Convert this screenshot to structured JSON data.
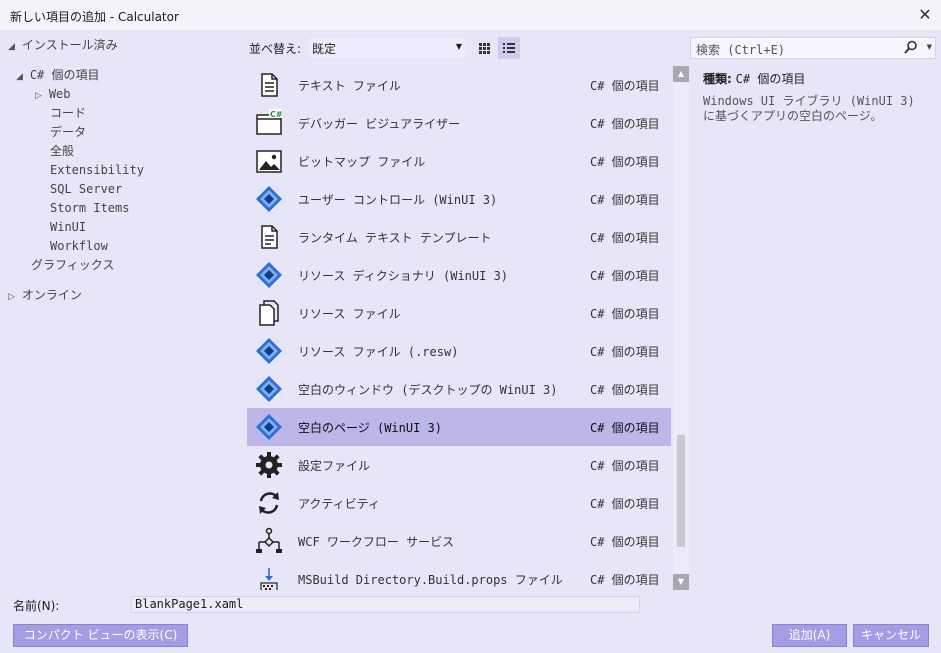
{
  "window": {
    "title": "新しい項目の追加 - Calculator",
    "close_glyph": "✕"
  },
  "tree": {
    "installed": "インストール済み",
    "csharp": "C# 個の項目",
    "web": "Web",
    "code": "コード",
    "data": "データ",
    "general": "全般",
    "extensibility": "Extensibility",
    "sql": "SQL Server",
    "storm": "Storm Items",
    "winui": "WinUI",
    "workflow": "Workflow",
    "graphics": "グラフィックス",
    "online": "オンライン"
  },
  "toolbar": {
    "sort_label": "並べ替え:",
    "sort_value": "既定"
  },
  "search": {
    "placeholder": "検索 (Ctrl+E)"
  },
  "templates": [
    {
      "name": "テキスト ファイル",
      "category": "C# 個の項目",
      "icon": "document-icon"
    },
    {
      "name": "デバッガー ビジュアライザー",
      "category": "C# 個の項目",
      "icon": "debugger-visualizer-icon"
    },
    {
      "name": "ビットマップ ファイル",
      "category": "C# 個の項目",
      "icon": "bitmap-icon"
    },
    {
      "name": "ユーザー コントロール (WinUI 3)",
      "category": "C# 個の項目",
      "icon": "winui-icon"
    },
    {
      "name": "ランタイム テキスト テンプレート",
      "category": "C# 個の項目",
      "icon": "text-template-icon"
    },
    {
      "name": "リソース ディクショナリ (WinUI 3)",
      "category": "C# 個の項目",
      "icon": "winui-icon"
    },
    {
      "name": "リソース ファイル",
      "category": "C# 個の項目",
      "icon": "resource-file-icon"
    },
    {
      "name": "リソース ファイル (.resw)",
      "category": "C# 個の項目",
      "icon": "winui-icon"
    },
    {
      "name": "空白のウィンドウ (デスクトップの WinUI 3)",
      "category": "C# 個の項目",
      "icon": "winui-icon"
    },
    {
      "name": "空白のページ (WinUI 3)",
      "category": "C# 個の項目",
      "icon": "winui-icon",
      "selected": true
    },
    {
      "name": "設定ファイル",
      "category": "C# 個の項目",
      "icon": "settings-gear-icon"
    },
    {
      "name": "アクティビティ",
      "category": "C# 個の項目",
      "icon": "activity-icon"
    },
    {
      "name": "WCF ワークフロー サービス",
      "category": "C# 個の項目",
      "icon": "workflow-service-icon"
    },
    {
      "name": "MSBuild Directory.Build.props ファイル",
      "category": "C# 個の項目",
      "icon": "msbuild-icon"
    }
  ],
  "details": {
    "kind_label": "種類:",
    "kind_value": "C# 個の項目",
    "description": "Windows UI ライブラリ (WinUI 3) に基づくアプリの空白のページ。"
  },
  "name_field": {
    "label": "名前(N):",
    "value": "BlankPage1.xaml"
  },
  "buttons": {
    "compact": "コンパクト ビューの表示(C)",
    "add": "追加(A)",
    "cancel": "キャンセル"
  },
  "colors": {
    "background": "#e6e6f8",
    "accent": "#a59de3",
    "selection": "#bdb6e8",
    "winui_blue": "#2d6fd6"
  }
}
